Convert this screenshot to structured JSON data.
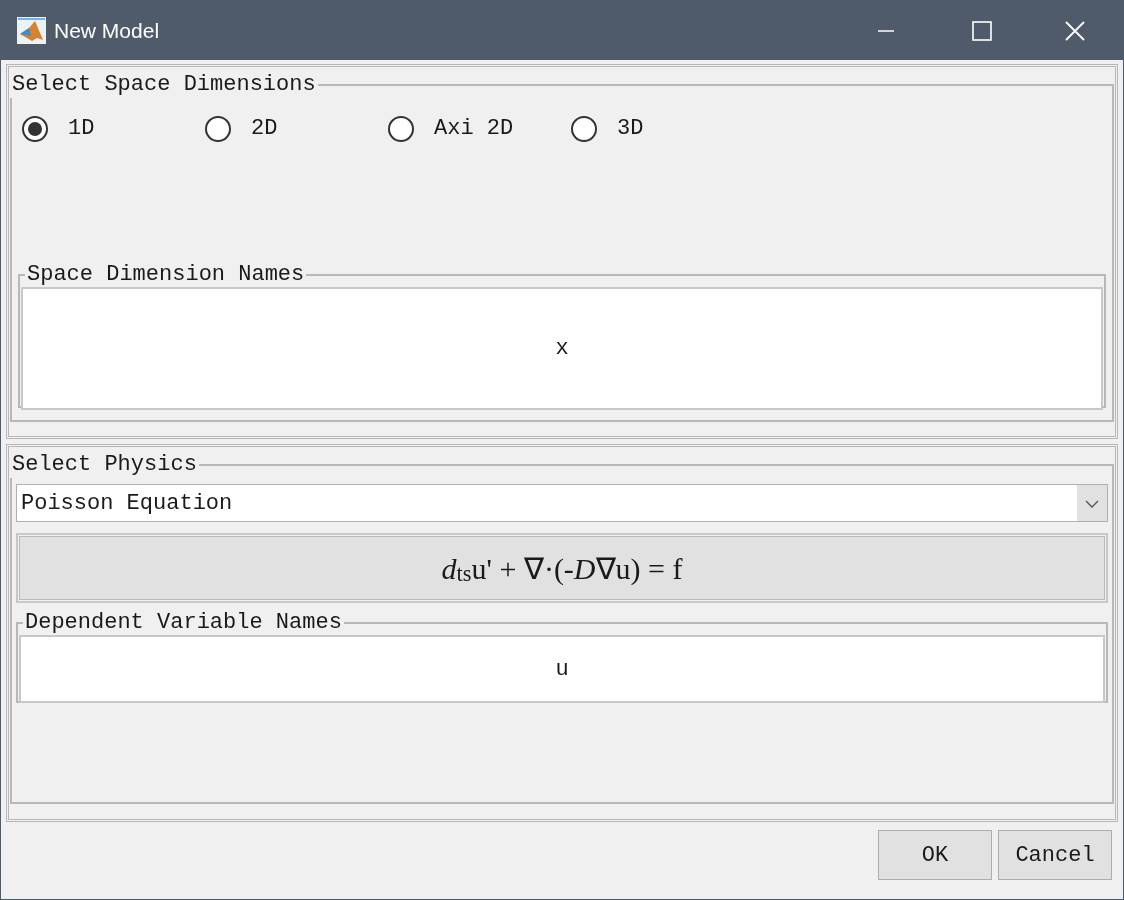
{
  "window": {
    "title": "New Model"
  },
  "space_dimensions": {
    "title": "Select Space Dimensions",
    "options": [
      {
        "label": "1D",
        "selected": true
      },
      {
        "label": "2D",
        "selected": false
      },
      {
        "label": "Axi 2D",
        "selected": false
      },
      {
        "label": "3D",
        "selected": false
      }
    ],
    "names": {
      "title": "Space Dimension Names",
      "value": "x"
    }
  },
  "physics": {
    "title": "Select Physics",
    "dropdown": {
      "value": "Poisson Equation"
    },
    "equation": "*d*$_{ts}$u' + ∇·(-*D*∇u) = f",
    "dependent_variables": {
      "title": "Dependent Variable Names",
      "value": "u"
    }
  },
  "buttons": [
    "OK",
    "Cancel"
  ]
}
